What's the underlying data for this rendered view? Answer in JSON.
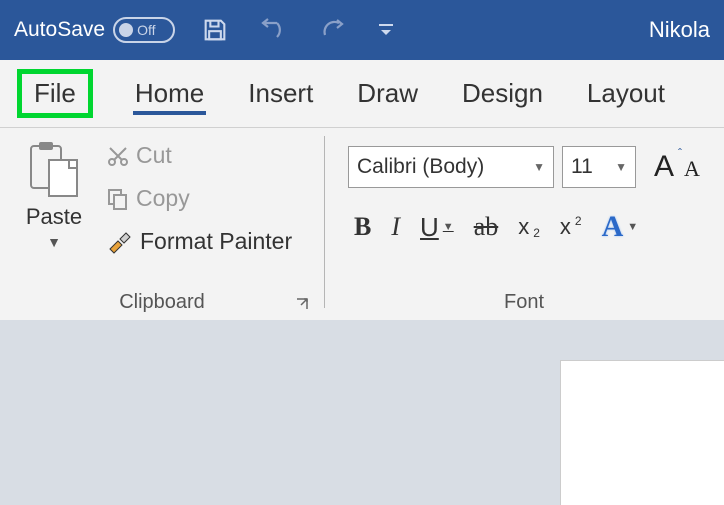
{
  "titlebar": {
    "autosave_label": "AutoSave",
    "autosave_state": "Off",
    "user": "Nikola"
  },
  "tabs": {
    "file": "File",
    "home": "Home",
    "insert": "Insert",
    "draw": "Draw",
    "design": "Design",
    "layout": "Layout"
  },
  "clipboard": {
    "paste": "Paste",
    "cut": "Cut",
    "copy": "Copy",
    "format_painter": "Format Painter",
    "group_label": "Clipboard"
  },
  "font": {
    "name_value": "Calibri (Body)",
    "size_value": "11",
    "bold": "B",
    "italic": "I",
    "underline": "U",
    "strike": "ab",
    "subscript": "x",
    "subscript_sub": "2",
    "superscript": "x",
    "superscript_sup": "2",
    "text_effects": "A",
    "grow": "A",
    "shrink": "A",
    "group_label": "Font"
  }
}
